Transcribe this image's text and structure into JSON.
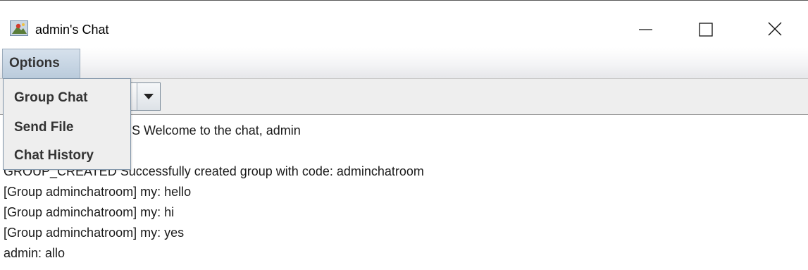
{
  "window": {
    "title": "admin's Chat",
    "icon": "java-app-icon",
    "controls": [
      "minimize-icon",
      "maximize-icon",
      "close-icon"
    ]
  },
  "menubar": {
    "options_label": "Options"
  },
  "options_menu": {
    "items": [
      {
        "label": "Group Chat"
      },
      {
        "label": "Send File"
      },
      {
        "label": "Chat History"
      }
    ]
  },
  "toolbar": {
    "combo_value": "",
    "combo_arrow": "chevron-down-icon"
  },
  "chat": {
    "lines": [
      "S Welcome to the chat, admin",
      "",
      "GROUP_CREATED Successfully created group with code: adminchatroom",
      "[Group adminchatroom] my: hello",
      "[Group adminchatroom] my: hi",
      "[Group adminchatroom] my: yes",
      "admin: allo"
    ]
  }
}
